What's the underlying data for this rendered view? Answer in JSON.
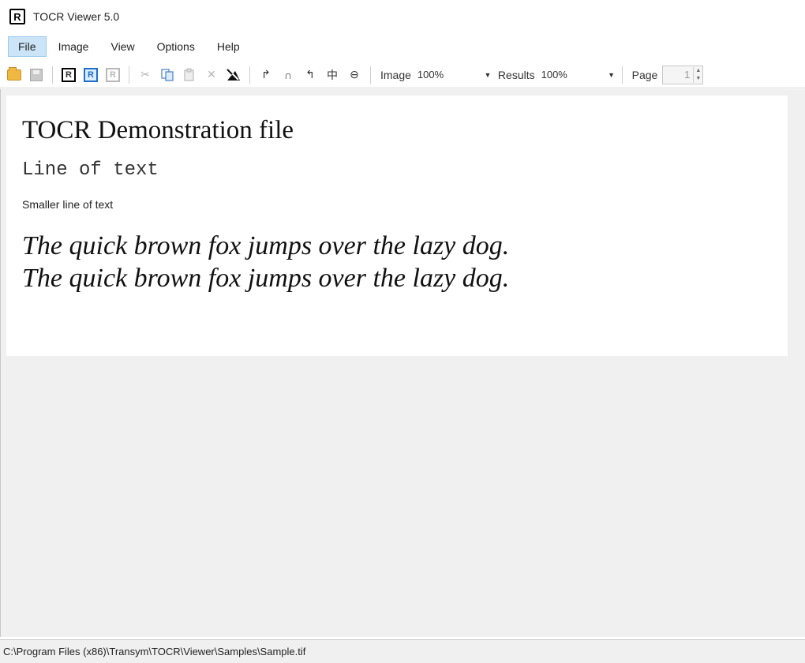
{
  "window": {
    "title": "TOCR Viewer 5.0",
    "app_icon_letter": "R"
  },
  "menu": [
    {
      "label": "File",
      "active": true
    },
    {
      "label": "Image",
      "active": false
    },
    {
      "label": "View",
      "active": false
    },
    {
      "label": "Options",
      "active": false
    },
    {
      "label": "Help",
      "active": false
    }
  ],
  "toolbar": {
    "r_box_letter": "R",
    "image_label": "Image",
    "image_zoom": "100%",
    "results_label": "Results",
    "results_zoom": "100%",
    "page_label": "Page",
    "page_value": "1",
    "icons": {
      "open": "folder-open-icon",
      "save": "save-icon",
      "cut": "cut-icon",
      "copy": "copy-icon",
      "paste": "paste-icon",
      "delete": "delete-icon",
      "deskew": "deskew-icon",
      "rotate_right": "rotate-right-icon",
      "rotate_180": "rotate-180-icon",
      "rotate_left": "rotate-left-icon",
      "flip_horizontal": "flip-horizontal-icon",
      "flip_vertical": "flip-vertical-icon"
    }
  },
  "document": {
    "heading": "TOCR Demonstration file",
    "mono_line": "Line of text",
    "small_line": "Smaller line of text",
    "italic_para": "The quick brown fox jumps over the lazy dog.  The quick brown fox jumps over the lazy dog."
  },
  "status": {
    "path": "C:\\Program Files (x86)\\Transym\\TOCR\\Viewer\\Samples\\Sample.tif"
  },
  "colors": {
    "menu_active_bg": "#cce4f7",
    "workspace_bg": "#f0f0f0",
    "accent_blue": "#1f6fc8"
  }
}
